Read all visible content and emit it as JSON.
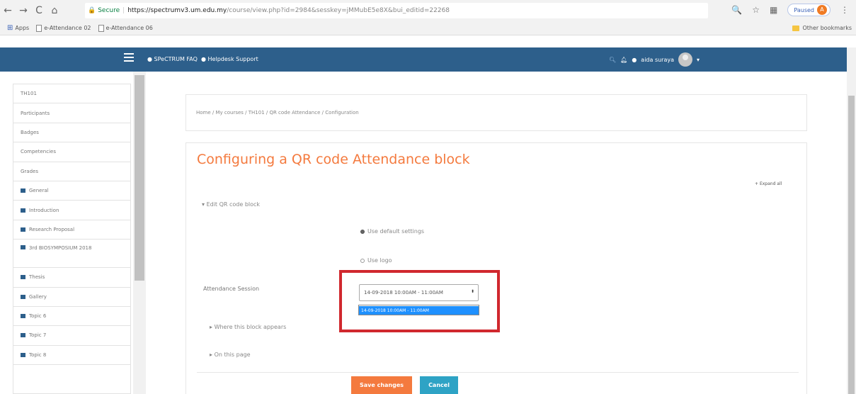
{
  "browser": {
    "secure_label": "Secure",
    "url_host": "https://spectrumv3.um.edu.my",
    "url_path": "/course/view.php?id=2984&sesskey=jMMubE5e8X&bui_editid=22268",
    "paused_label": "Paused",
    "profile_initial": "A"
  },
  "bookmarks": {
    "apps": "Apps",
    "items": [
      "e-Attendance 02",
      "e-Attendance 06"
    ],
    "other": "Other bookmarks"
  },
  "navbar": {
    "faq": "SPeCTRUM FAQ",
    "helpdesk": "Helpdesk Support",
    "username": "aida suraya"
  },
  "sidebar": {
    "items": [
      {
        "label": "TH101",
        "folder": false
      },
      {
        "label": "Participants",
        "folder": false
      },
      {
        "label": "Badges",
        "folder": false
      },
      {
        "label": "Competencies",
        "folder": false
      },
      {
        "label": "Grades",
        "folder": false
      },
      {
        "label": "General",
        "folder": true
      },
      {
        "label": "Introduction",
        "folder": true
      },
      {
        "label": "Research Proposal",
        "folder": true
      },
      {
        "label": "3rd BIOSYMPOSIUM 2018",
        "folder": true
      },
      {
        "label": "Thesis",
        "folder": true
      },
      {
        "label": "Gallery",
        "folder": true
      },
      {
        "label": "Topic 6",
        "folder": true
      },
      {
        "label": "Topic 7",
        "folder": true
      },
      {
        "label": "Topic 8",
        "folder": true
      }
    ]
  },
  "breadcrumb": "Home / My courses / TH101 / QR code Attendance / Configuration",
  "main": {
    "title": "Configuring a QR code Attendance block",
    "expand_all": "Expand all",
    "edit_section": "Edit QR code block",
    "option_default": "Use default settings",
    "option_logo": "Use logo",
    "attendance_label": "Attendance Session",
    "session_value": "14-09-2018 10:00AM - 11:00AM",
    "dropdown_option": "14-09-2018 10:00AM - 11:00AM",
    "where_section": "Where this block appears",
    "on_page_section": "On this page",
    "save_label": "Save changes",
    "cancel_label": "Cancel"
  }
}
